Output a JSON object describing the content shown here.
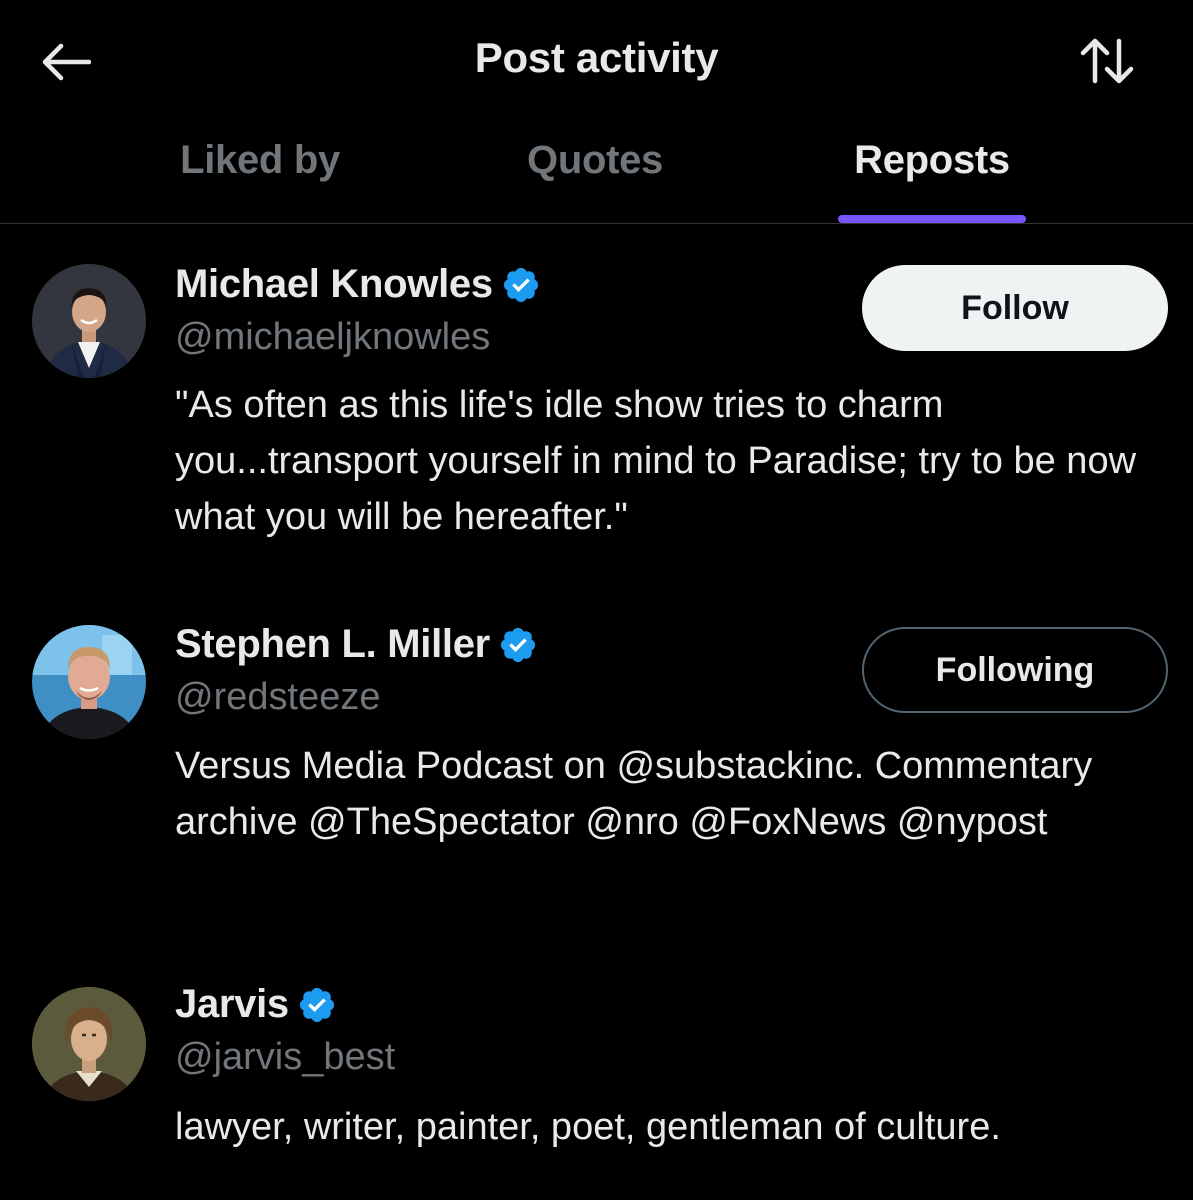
{
  "header": {
    "title": "Post activity",
    "back_icon": "arrow-left-icon",
    "sort_icon": "sort-arrows-icon"
  },
  "tabs": [
    {
      "label": "Liked by",
      "active": false
    },
    {
      "label": "Quotes",
      "active": false
    },
    {
      "label": "Reposts",
      "active": true
    }
  ],
  "colors": {
    "accent": "#7856ff",
    "verified": "#1d9bf0",
    "background": "#000000",
    "muted": "#71767b"
  },
  "users": [
    {
      "name": "Michael Knowles",
      "verified": true,
      "handle": "@michaeljknowles",
      "bio": "\"As often as this life's idle show tries to charm you...transport yourself in mind to Paradise; try to be now what you will be hereafter.\"",
      "button": "Follow"
    },
    {
      "name": "Stephen L. Miller",
      "verified": true,
      "handle": "@redsteeze",
      "bio": "Versus Media Podcast on @substackinc. Commentary archive @TheSpectator @nro @FoxNews @nypost",
      "button": "Following"
    },
    {
      "name": "Jarvis",
      "verified": true,
      "handle": "@jarvis_best",
      "bio": "lawyer, writer, painter, poet, gentleman of culture."
    }
  ]
}
